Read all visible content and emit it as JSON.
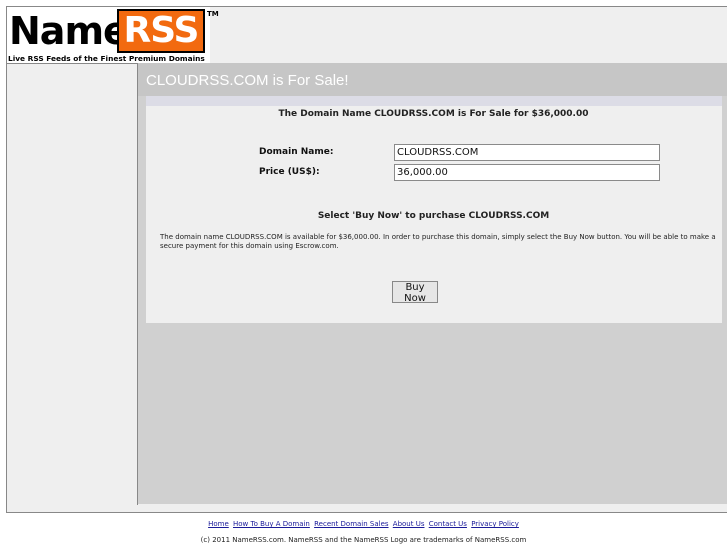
{
  "logo": {
    "name": "Name",
    "rss": "RSS",
    "tm": "TM",
    "tagline": "Live RSS Feeds of the Finest Premium Domains"
  },
  "main": {
    "title": "CLOUDRSS.COM is For Sale!",
    "headline": "The Domain Name CLOUDRSS.COM is For Sale for $36,000.00",
    "domain_label": "Domain Name:",
    "domain_value": "CLOUDRSS.COM",
    "price_label": "Price (US$):",
    "price_value": "36,000.00",
    "select_text": "Select 'Buy Now' to purchase CLOUDRSS.COM",
    "info_text": "The domain name CLOUDRSS.COM is available for $36,000.00. In order to purchase this domain, simply select the Buy Now button. You will be able to make a secure payment for this domain using Escrow.com.",
    "buy_button": "Buy Now"
  },
  "footer": {
    "links": [
      "Home",
      "How To Buy A Domain",
      "Recent Domain Sales",
      "About Us",
      "Contact Us",
      "Privacy Policy"
    ],
    "copyright": "(c) 2011 NameRSS.com. NameRSS and the NameRSS Logo are trademarks of NameRSS.com"
  },
  "colors": {
    "brand_orange": "#f26a0f",
    "link": "#1a1a99",
    "main_bg": "#d0d0d0"
  }
}
